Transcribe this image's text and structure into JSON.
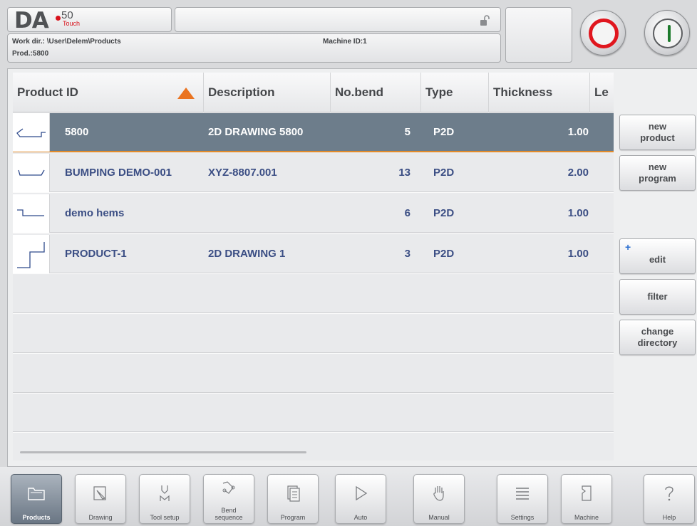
{
  "header": {
    "logo": {
      "brand": "DA",
      "model": "50",
      "edition": "Touch"
    },
    "work_dir": "Work dir.: \\User\\Delem\\Products",
    "product": "Prod.:5800",
    "machine_id": "Machine ID:1",
    "icons": [
      "lock-open-icon"
    ],
    "controls": {
      "stop": "stop-button",
      "start": "start-button"
    }
  },
  "table": {
    "columns": [
      "Product ID",
      "Description",
      "No.bend",
      "Type",
      "Thickness",
      "Le"
    ],
    "sort_column": "Product ID",
    "rows": [
      {
        "id": "5800",
        "description": "2D DRAWING 5800",
        "bends": "5",
        "type": "P2D",
        "thickness": "1.00",
        "selected": true
      },
      {
        "id": "BUMPING DEMO-001",
        "description": "XYZ-8807.001",
        "bends": "13",
        "type": "P2D",
        "thickness": "2.00",
        "selected": false
      },
      {
        "id": "demo hems",
        "description": "",
        "bends": "6",
        "type": "P2D",
        "thickness": "1.00",
        "selected": false
      },
      {
        "id": "PRODUCT-1",
        "description": "2D DRAWING 1",
        "bends": "3",
        "type": "P2D",
        "thickness": "1.00",
        "selected": false
      }
    ]
  },
  "side_buttons": {
    "new_product": "new product",
    "new_program": "new program",
    "edit_plus": "+",
    "edit": "edit",
    "filter": "filter",
    "change_directory": "change directory"
  },
  "nav": {
    "products": "Products",
    "drawing": "Drawing",
    "tool_setup": "Tool setup",
    "bend_sequence": "Bend sequence",
    "program": "Program",
    "auto": "Auto",
    "manual": "Manual",
    "settings": "Settings",
    "machine": "Machine",
    "help": "Help"
  },
  "colors": {
    "selected_row": "#6d7d8b",
    "accent": "#e38b2a",
    "text_blue": "#3b4e84",
    "stop_red": "#e0161e",
    "start_green": "#1d7a2c"
  }
}
